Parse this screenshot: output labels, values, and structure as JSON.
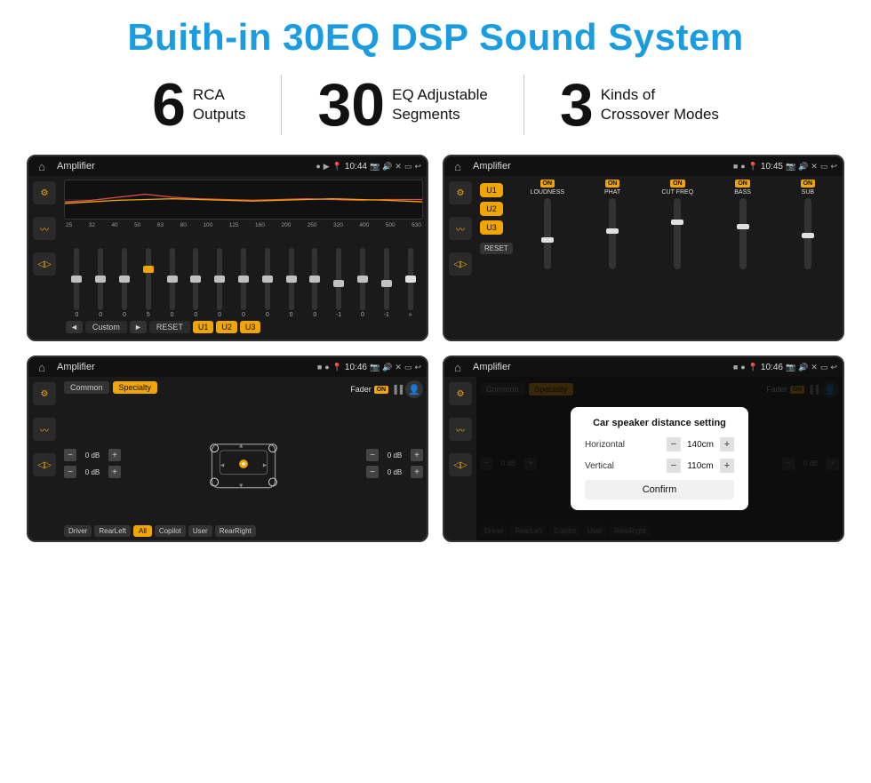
{
  "title": "Buith-in 30EQ DSP Sound System",
  "stats": [
    {
      "number": "6",
      "label_line1": "RCA",
      "label_line2": "Outputs"
    },
    {
      "number": "30",
      "label_line1": "EQ Adjustable",
      "label_line2": "Segments"
    },
    {
      "number": "3",
      "label_line1": "Kinds of",
      "label_line2": "Crossover Modes"
    }
  ],
  "screens": {
    "eq": {
      "status_title": "Amplifier",
      "time": "10:44",
      "freq_labels": [
        "25",
        "32",
        "40",
        "50",
        "63",
        "80",
        "100",
        "125",
        "160",
        "200",
        "250",
        "320",
        "400",
        "500",
        "630"
      ],
      "slider_values": [
        "0",
        "0",
        "0",
        "5",
        "0",
        "0",
        "0",
        "0",
        "0",
        "0",
        "0",
        "-1",
        "0",
        "-1"
      ],
      "buttons": [
        "◄",
        "Custom",
        "►",
        "RESET",
        "U1",
        "U2",
        "U3"
      ]
    },
    "amp": {
      "status_title": "Amplifier",
      "time": "10:45",
      "presets": [
        "U1",
        "U2",
        "U3"
      ],
      "controls": [
        {
          "on": true,
          "label": "LOUDNESS"
        },
        {
          "on": true,
          "label": "PHAT"
        },
        {
          "on": true,
          "label": "CUT FREQ"
        },
        {
          "on": true,
          "label": "BASS"
        },
        {
          "on": true,
          "label": "SUB"
        }
      ],
      "reset_label": "RESET"
    },
    "fader": {
      "status_title": "Amplifier",
      "time": "10:46",
      "tabs": [
        "Common",
        "Specialty"
      ],
      "fader_label": "Fader",
      "fader_on": "ON",
      "vol_controls": [
        {
          "value": "0 dB"
        },
        {
          "value": "0 dB"
        },
        {
          "value": "0 dB"
        },
        {
          "value": "0 dB"
        }
      ],
      "buttons": [
        "Driver",
        "RearLeft",
        "All",
        "Copilot",
        "RearRight",
        "User"
      ]
    },
    "dialog": {
      "status_title": "Amplifier",
      "time": "10:46",
      "tabs": [
        "Common",
        "Specialty"
      ],
      "dialog_title": "Car speaker distance setting",
      "horizontal_label": "Horizontal",
      "horizontal_value": "140cm",
      "vertical_label": "Vertical",
      "vertical_value": "110cm",
      "confirm_label": "Confirm",
      "vol_labels": [
        "0 dB",
        "0 dB"
      ],
      "buttons": [
        "Driver",
        "RearLeft",
        "Copilot",
        "RearRight",
        "User"
      ]
    }
  }
}
